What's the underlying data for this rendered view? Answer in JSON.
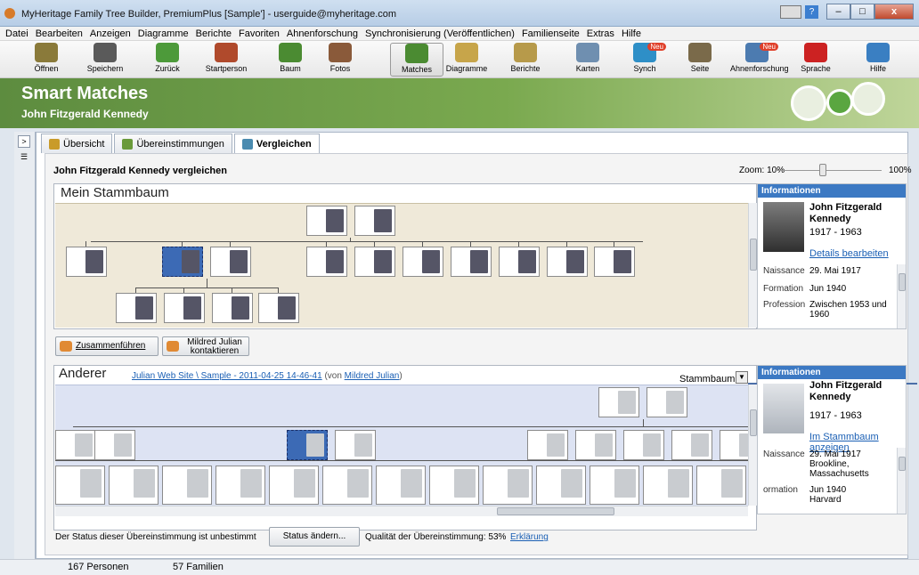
{
  "window": {
    "title": "MyHeritage Family Tree Builder, PremiumPlus [Sample'] - userguide@myheritage.com",
    "help_label": "?"
  },
  "menu": [
    "Datei",
    "Bearbeiten",
    "Anzeigen",
    "Diagramme",
    "Berichte",
    "Favoriten",
    "Ahnenforschung",
    "Synchronisierung (Veröffentlichen)",
    "Familienseite",
    "Extras",
    "Hilfe"
  ],
  "toolbar": [
    {
      "label": "Öffnen",
      "icon": "folder-icon",
      "color": "#8a7a3a"
    },
    {
      "label": "Speichern",
      "icon": "save-icon",
      "color": "#5a5a5a"
    },
    {
      "label": "Zurück",
      "icon": "back-arrow-icon",
      "color": "#4d9a3a"
    },
    {
      "label": "Startperson",
      "icon": "home-icon",
      "color": "#b04a2c"
    },
    {
      "label": "Baum",
      "icon": "tree-icon",
      "color": "#4b8b32"
    },
    {
      "label": "Fotos",
      "icon": "photos-icon",
      "color": "#8a5a3a"
    },
    {
      "label": "Matches",
      "icon": "matches-icon",
      "color": "#4b8b32",
      "active": true
    },
    {
      "label": "Diagramme",
      "icon": "chart-icon",
      "color": "#c7a54a"
    },
    {
      "label": "Berichte",
      "icon": "report-icon",
      "color": "#b79a4a"
    },
    {
      "label": "Karten",
      "icon": "map-icon",
      "color": "#6f8fb0"
    },
    {
      "label": "Synch",
      "icon": "sync-icon",
      "color": "#2e8fc7",
      "badge": "Neu"
    },
    {
      "label": "Seite",
      "icon": "family-icon",
      "color": "#7a6a4a"
    },
    {
      "label": "Ahnenforschung",
      "icon": "research-icon",
      "color": "#4c7bb0",
      "badge": "Neu"
    },
    {
      "label": "Sprache",
      "icon": "flag-de-icon",
      "color": "#cc2222"
    },
    {
      "label": "Hilfe",
      "icon": "help-icon",
      "color": "#3a7fc2"
    }
  ],
  "banner": {
    "title": "Smart Matches",
    "subtitle": "John Fitzgerald Kennedy"
  },
  "tabs": [
    {
      "label": "Übersicht"
    },
    {
      "label": "Übereinstimmungen"
    },
    {
      "label": "Vergleichen"
    }
  ],
  "compare": {
    "title": "John Fitzgerald Kennedy vergleichen",
    "zoom_label": "Zoom: 10%",
    "zoom_max": "100%",
    "zoom_value": 0.45
  },
  "mine": {
    "heading": "Mein Stammbaum"
  },
  "other": {
    "heading": "Anderer",
    "source_link": "Julian Web Site \\ Sample - 2011-04-25 14-46-41",
    "von": "(von",
    "owner": "Mildred Julian",
    "close_paren": ")",
    "view_select": "Stammbaum"
  },
  "actions": {
    "merge": "Zusammenführen",
    "contact_line1": "Mildred Julian",
    "contact_line2": "kontaktieren"
  },
  "info_mine": {
    "header": "Informationen",
    "name": "John Fitzgerald Kennedy",
    "years": "1917 - 1963",
    "link": "Details bearbeiten",
    "facts": [
      {
        "k": "Naissance",
        "v": "29. Mai 1917"
      },
      {
        "k": "Formation",
        "v": "Jun 1940"
      },
      {
        "k": "Profession",
        "v": "Zwischen 1953 und 1960"
      }
    ]
  },
  "info_other": {
    "header": "Informationen",
    "name": "John Fitzgerald Kennedy",
    "years": "1917 - 1963",
    "link": "Im Stammbaum anzeigen",
    "facts": [
      {
        "k": "Naissance",
        "v": "29. Mai 1917 Brookline, Massachusetts"
      },
      {
        "k": "ormation",
        "v": "Jun 1940 Harvard"
      }
    ]
  },
  "status": {
    "text": "Der Status dieser Übereinstimmung ist unbestimmt",
    "button": "Status ändern...",
    "quality": "Qualität der Übereinstimmung: 53%",
    "explain": "Erklärung"
  },
  "statusbar": {
    "persons": "167 Personen",
    "families": "57 Familien"
  }
}
